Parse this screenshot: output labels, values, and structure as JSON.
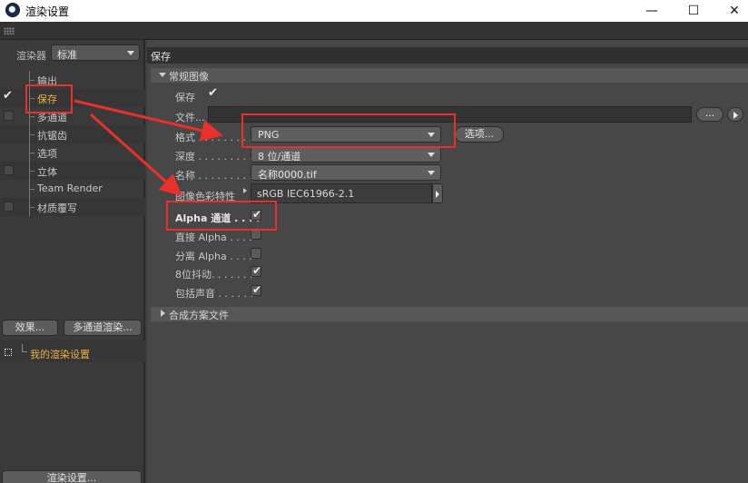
{
  "window": {
    "title": "渲染设置",
    "minimize_glyph": "—",
    "maximize_glyph": "☐",
    "close_glyph": "✕"
  },
  "left_panel": {
    "renderer_label": "渲染器",
    "renderer_value": "标准",
    "tree": [
      {
        "label": "输出",
        "checked": null,
        "active": false
      },
      {
        "label": "保存",
        "checked": true,
        "active": true
      },
      {
        "label": "多通道",
        "checked": false,
        "active": false
      },
      {
        "label": "抗锯齿",
        "checked": null,
        "active": false
      },
      {
        "label": "选项",
        "checked": null,
        "active": false
      },
      {
        "label": "立体",
        "checked": false,
        "active": false
      },
      {
        "label": "Team Render",
        "checked": null,
        "active": false
      },
      {
        "label": "材质覆写",
        "checked": false,
        "active": false
      }
    ],
    "effects_button": "效果...",
    "multipass_button": "多通道渲染...",
    "settings_item": "我的渲染设置",
    "render_settings_button": "渲染设置..."
  },
  "right_panel": {
    "section_title": "保存",
    "general_group": "常规图像",
    "save_label": "保存",
    "save_checked": true,
    "file_label": "文件...",
    "file_value": "",
    "dots_button": "...",
    "format_label": "格式 . . . . . . . . .",
    "format_value": "PNG",
    "options_button": "选项...",
    "depth_label": "深度 . . . . . . . . .",
    "depth_value": "8 位/通道",
    "name_label": "名称 . . . . . . . . .",
    "name_value": "名称0000.tif",
    "color_profile_label": "图像色彩特性",
    "color_profile_value": "sRGB IEC61966-2.1",
    "alpha_label": "Alpha 通道 . . . .",
    "alpha_checked": true,
    "straight_alpha_label": "直接 Alpha . . . .",
    "straight_alpha_checked": false,
    "separate_alpha_label": "分离 Alpha . . . .",
    "separate_alpha_checked": false,
    "dither_label": "8位抖动. . . . . . .",
    "dither_checked": true,
    "sound_label": "包括声音 . . . . . .",
    "sound_checked": true,
    "compositing_group": "合成方案文件"
  },
  "annotation_color": "#e8302c"
}
